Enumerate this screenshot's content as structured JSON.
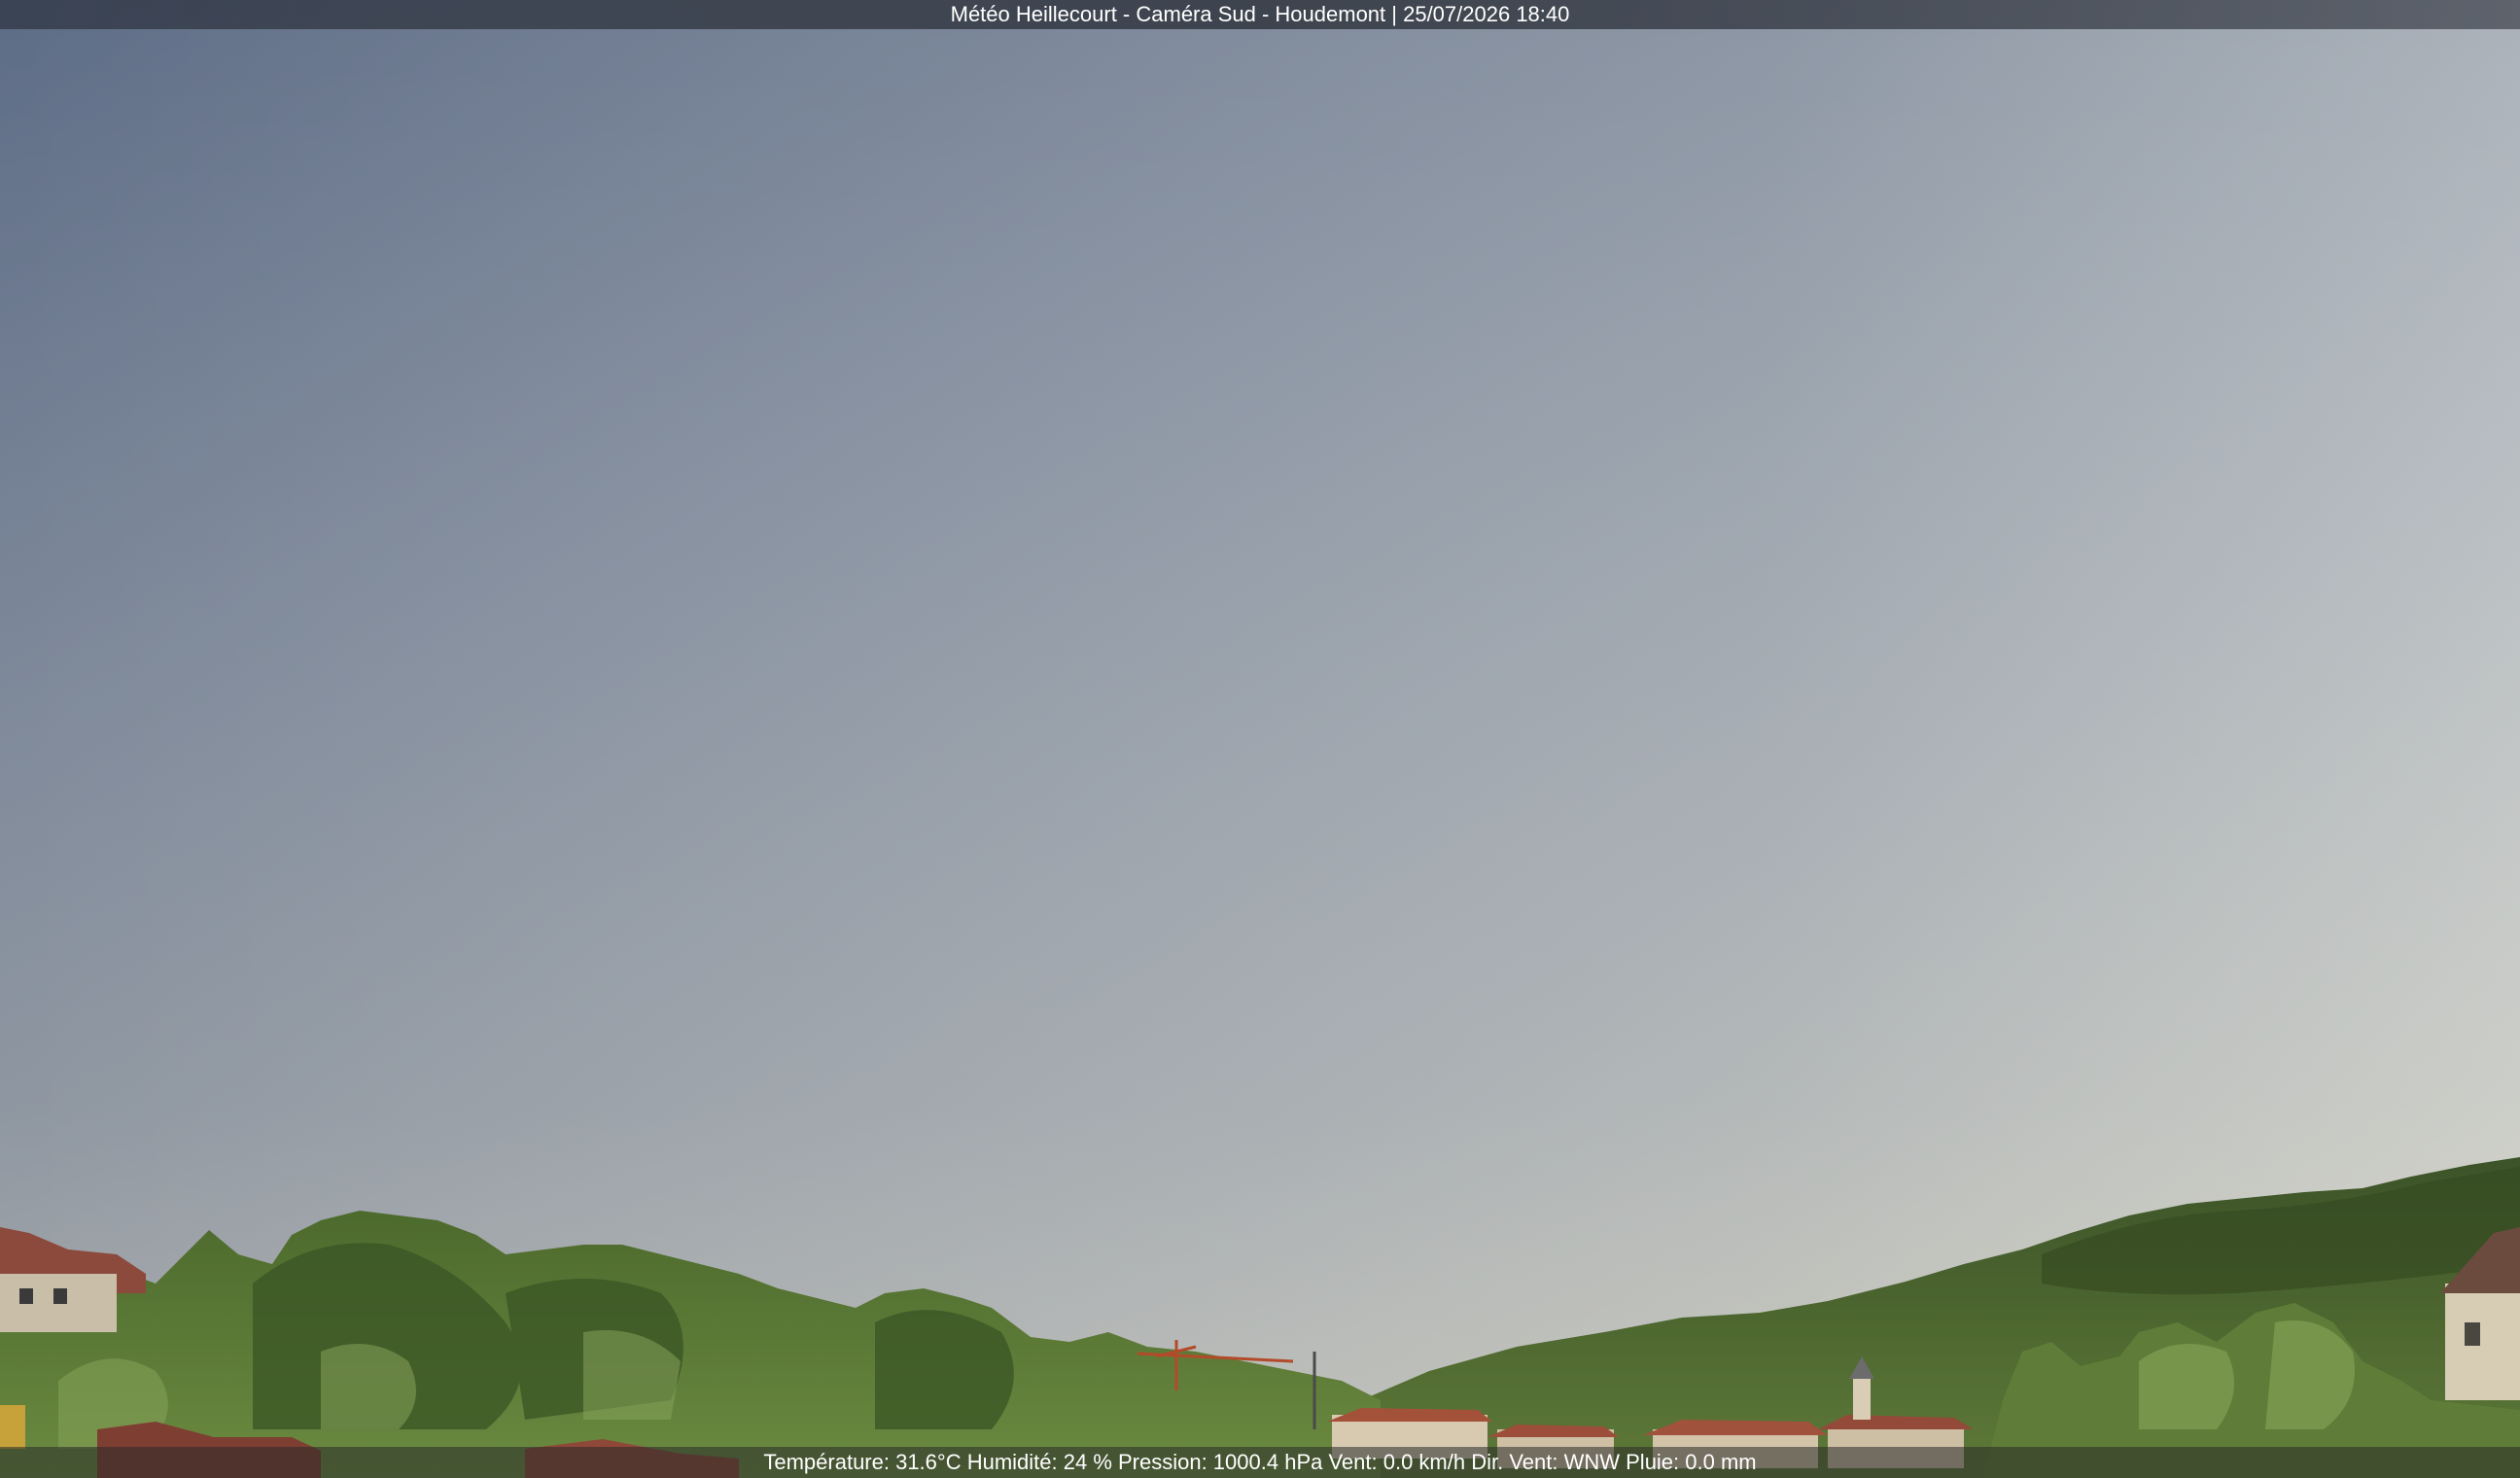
{
  "overlay": {
    "header": "Météo Heillecourt - Caméra Sud - Houdemont | 25/07/2026 18:40",
    "footer": "Température: 31.6°C  Humidité: 24 % Pression: 1000.4 hPa Vent: 0.0 km/h Dir. Vent: WNW Pluie: 0.0 mm"
  },
  "colors": {
    "sky_top_left": "#5f6e87",
    "sky_mid": "#8e98a6",
    "sky_right": "#c3c9cc",
    "horizon_warm": "#d9d4c0",
    "foliage_dark": "#2f4520",
    "foliage_light": "#6f8e3e",
    "roof_red": "#9c4e3a"
  }
}
